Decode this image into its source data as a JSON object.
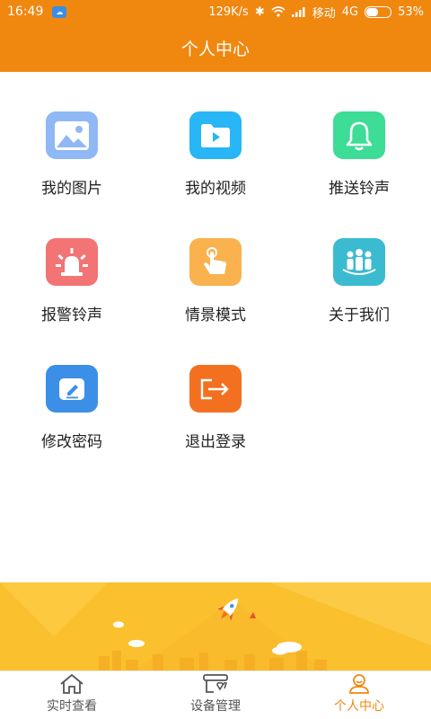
{
  "status_bar": {
    "time": "16:49",
    "speed": "129K/s",
    "carrier": "移动",
    "network": "4G",
    "battery_percent": "53%",
    "battery_level": 0.53
  },
  "header": {
    "title": "个人中心"
  },
  "grid": {
    "items": [
      {
        "label": "我的图片",
        "icon": "image-icon",
        "color": "#8fb8f5"
      },
      {
        "label": "我的视频",
        "icon": "video-folder-icon",
        "color": "#29b6f6"
      },
      {
        "label": "推送铃声",
        "icon": "bell-icon",
        "color": "#3ddc97"
      },
      {
        "label": "报警铃声",
        "icon": "alarm-light-icon",
        "color": "#f27474"
      },
      {
        "label": "情景模式",
        "icon": "hand-touch-icon",
        "color": "#f9b24d"
      },
      {
        "label": "关于我们",
        "icon": "team-icon",
        "color": "#3bbbd0"
      },
      {
        "label": "修改密码",
        "icon": "edit-password-icon",
        "color": "#3b8fe6"
      },
      {
        "label": "退出登录",
        "icon": "logout-icon",
        "color": "#f37021"
      }
    ]
  },
  "tabs": [
    {
      "label": "实时查看",
      "icon": "home-icon",
      "active": false
    },
    {
      "label": "设备管理",
      "icon": "device-icon",
      "active": false
    },
    {
      "label": "个人中心",
      "icon": "person-icon",
      "active": true
    }
  ],
  "colors": {
    "accent": "#f0870f",
    "banner": "#fbc02d"
  }
}
